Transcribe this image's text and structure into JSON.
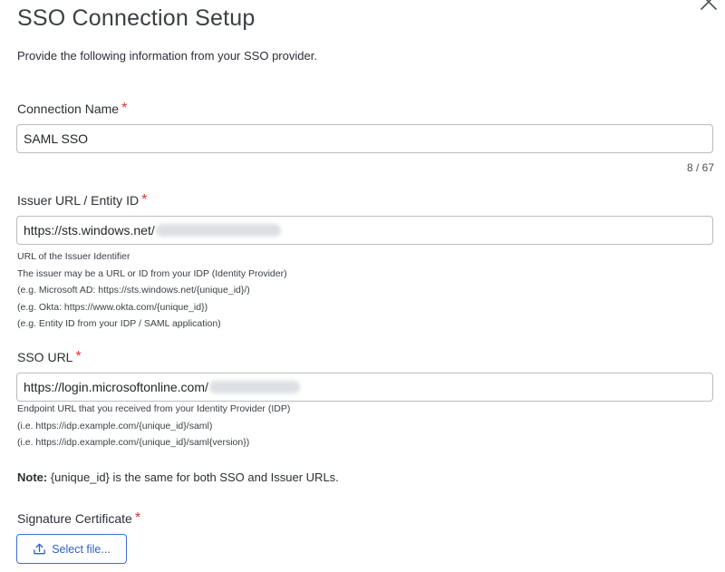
{
  "dialog": {
    "title": "SSO Connection Setup",
    "subtitle": "Provide the following information from your SSO provider."
  },
  "connection_name": {
    "label": "Connection Name",
    "required_mark": "*",
    "value": "SAML SSO",
    "counter": "8 / 67"
  },
  "issuer": {
    "label": "Issuer URL / Entity ID",
    "required_mark": "*",
    "value": "https://sts.windows.net/",
    "help": [
      "URL of the Issuer Identifier",
      "The issuer may be a URL or ID from your IDP (Identity Provider)",
      "(e.g. Microsoft AD: https://sts.windows.net/{unique_id}/)",
      "(e.g. Okta: https://www.okta.com/{unique_id})",
      "(e.g. Entity ID from your IDP / SAML application)"
    ]
  },
  "sso_url": {
    "label": "SSO URL",
    "required_mark": "*",
    "value": "https://login.microsoftonline.com/",
    "help": [
      "Endpoint URL that you received from your Identity Provider (IDP)",
      "(i.e. https://idp.example.com/{unique_id}/saml)",
      "(i.e. https://idp.example.com/{unique_id}/saml{version})"
    ]
  },
  "note": {
    "prefix": "Note:",
    "text": " {unique_id} is the same for both SSO and Issuer URLs."
  },
  "certificate": {
    "label": "Signature Certificate",
    "required_mark": "*",
    "button_label": "Select file..."
  },
  "icons": {
    "close": "close-icon",
    "upload": "upload-icon"
  },
  "colors": {
    "required": "#e0312d",
    "accent": "#2f5fc8",
    "input_border": "#b9bcc2"
  }
}
